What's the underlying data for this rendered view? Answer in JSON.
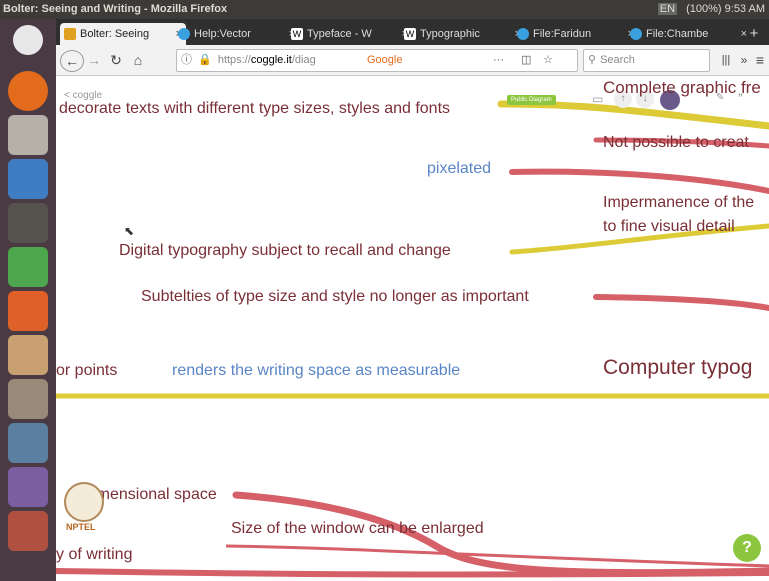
{
  "window": {
    "title": "Bolter: Seeing and Writing - Mozilla Firefox",
    "status": "(100%)  9:53 AM",
    "kbd": "EN"
  },
  "tabs": [
    {
      "label": "Bolter: Seeing",
      "color": "#e0a020"
    },
    {
      "label": "Help:Vector",
      "color": "#3aa0e0"
    },
    {
      "label": "Typeface - W",
      "color": "#ffffff"
    },
    {
      "label": "Typographic",
      "color": "#ffffff"
    },
    {
      "label": "File:Faridun",
      "color": "#3aa0e0"
    },
    {
      "label": "File:Chambe",
      "color": "#3aa0e0"
    }
  ],
  "nav": {
    "url_prefix": "https://",
    "url_domain": "coggle.it",
    "url_rest": "/diag",
    "search_engine": "Google",
    "search_placeholder": "Search"
  },
  "mindmap": {
    "back_link": "< coggle",
    "badge": "Public Diagram",
    "nodes": {
      "decorate": "decorate texts with different type sizes, styles and fonts",
      "pixelated": "pixelated",
      "digital_typography": "Digital typography subject to recall and change",
      "subtelties": "Subtelties of type size and style no longer as important",
      "or_points": "or points",
      "measurable": "renders the writing space as measurable",
      "two_dim": "o-dimensional space",
      "window_size": "Size of the window can be enlarged",
      "of_writing": "y of writing",
      "complete_graphic": "Complete graphic fre",
      "not_possible": "Not possible to creat",
      "impermanence_1": "Impermanence of the",
      "impermanence_2": "to fine visual detail",
      "computer_typog": "Computer typog"
    }
  },
  "logo_text": "NPTEL",
  "help": "?",
  "colors": {
    "yellow": "#dccb37",
    "red": "#d66068",
    "dark_text": "#7a2f36",
    "blue_text": "#5a86c5"
  }
}
